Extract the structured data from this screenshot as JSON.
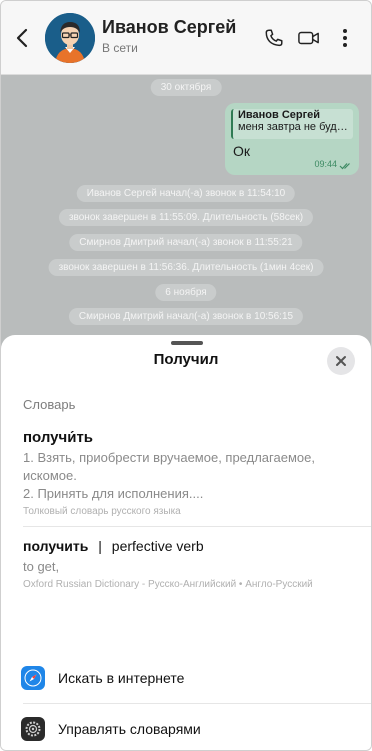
{
  "header": {
    "back_icon": "chevron-left-icon",
    "contact_name": "Иванов Сергей",
    "status": "В сети",
    "icons": [
      "phone-icon",
      "video-icon",
      "more-vertical-icon"
    ]
  },
  "chat": {
    "date_1": "30 октября",
    "message": {
      "reply_name": "Иванов Сергей",
      "reply_text": "меня завтра не будет...",
      "text": "Ок",
      "time": "09:44"
    },
    "events": [
      "Иванов Сергей начал(-а) звонок в 11:54:10",
      "звонок завершен в 11:55:09. Длительность (58сек)",
      "Смирнов Дмитрий начал(-а) звонок в 11:55:21",
      "звонок завершен в 11:56:36. Длительность (1мин 4сек)"
    ],
    "date_2": "6 ноября",
    "event_after": "Смирнов Дмитрий начал(-а) звонок в 10:56:15"
  },
  "sheet": {
    "title": "Получил",
    "section_label": "Словарь",
    "entry1": {
      "word": "получи́ть",
      "def_line1": "1. Взять, приобрести вручаемое, предлагаемое,",
      "def_line2": "искомое.",
      "def_line3": "2. Принять для исполнения....",
      "source": "Толковый словарь русского языка"
    },
    "entry2": {
      "word": "получить",
      "separator": "|",
      "pos": "perfective verb",
      "def": "to get,",
      "source": "Oxford Russian Dictionary - Русско-Английский • Англо-Русский"
    },
    "actions": {
      "search_web": "Искать в интернете",
      "manage_dictionaries": "Управлять словарями"
    }
  },
  "colors": {
    "bubble": "#b5d6c4",
    "time_accent": "#3d8a63",
    "safari_blue": "#1f86e8"
  }
}
